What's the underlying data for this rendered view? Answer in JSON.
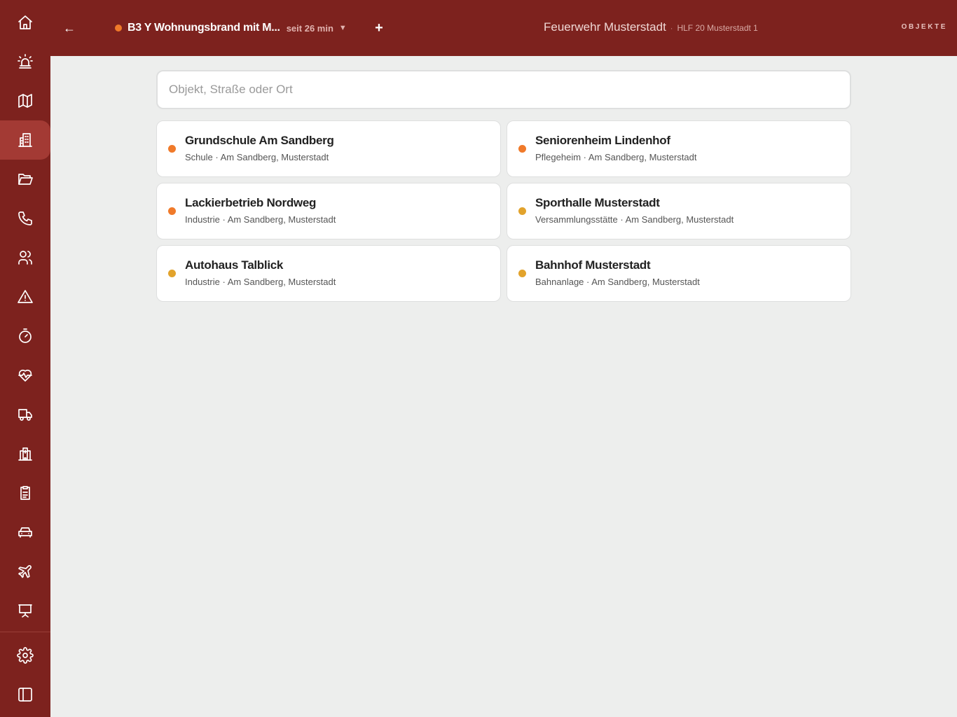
{
  "sidebar": {
    "items": [
      {
        "name": "home-icon"
      },
      {
        "name": "alarm-light-icon"
      },
      {
        "name": "map-icon"
      },
      {
        "name": "building-icon",
        "active": true
      },
      {
        "name": "folder-open-icon"
      },
      {
        "name": "phone-icon"
      },
      {
        "name": "users-icon"
      },
      {
        "name": "warning-icon"
      },
      {
        "name": "stopwatch-icon"
      },
      {
        "name": "heart-pulse-icon"
      },
      {
        "name": "truck-icon"
      },
      {
        "name": "hospital-icon"
      },
      {
        "name": "clipboard-icon"
      },
      {
        "name": "car-icon"
      },
      {
        "name": "plane-icon"
      },
      {
        "name": "presentation-icon"
      },
      {
        "name": "gear-icon"
      },
      {
        "name": "sidebar-toggle-icon"
      }
    ]
  },
  "topbar": {
    "back_label": "←",
    "incident": {
      "title": "B3 Y Wohnungsbrand mit M...",
      "since": "seit 26 min",
      "caret": "▼",
      "status_color": "#f07a2a"
    },
    "add_label": "+",
    "org_name": "Feuerwehr Musterstadt",
    "org_separator": "·",
    "unit": "HLF 20 Musterstadt 1",
    "page_label": "OBJEKTE"
  },
  "search": {
    "placeholder": "Objekt, Straße oder Ort",
    "value": ""
  },
  "objects": [
    {
      "name": "Grundschule Am Sandberg",
      "meta": "Schule · Am Sandberg, Musterstadt",
      "status": "orange"
    },
    {
      "name": "Seniorenheim Lindenhof",
      "meta": "Pflegeheim · Am Sandberg, Musterstadt",
      "status": "orange"
    },
    {
      "name": "Lackierbetrieb Nordweg",
      "meta": "Industrie · Am Sandberg, Musterstadt",
      "status": "orange"
    },
    {
      "name": "Sporthalle Musterstadt",
      "meta": "Versammlungsstätte · Am Sandberg, Musterstadt",
      "status": "amber"
    },
    {
      "name": "Autohaus Talblick",
      "meta": "Industrie · Am Sandberg, Musterstadt",
      "status": "amber"
    },
    {
      "name": "Bahnhof Musterstadt",
      "meta": "Bahnanlage · Am Sandberg, Musterstadt",
      "status": "amber"
    }
  ],
  "colors": {
    "brand": "#7d221e",
    "active_nav": "#a33a34",
    "status_orange": "#f07a2a",
    "status_amber": "#e2a32c",
    "background": "#edeeed"
  }
}
